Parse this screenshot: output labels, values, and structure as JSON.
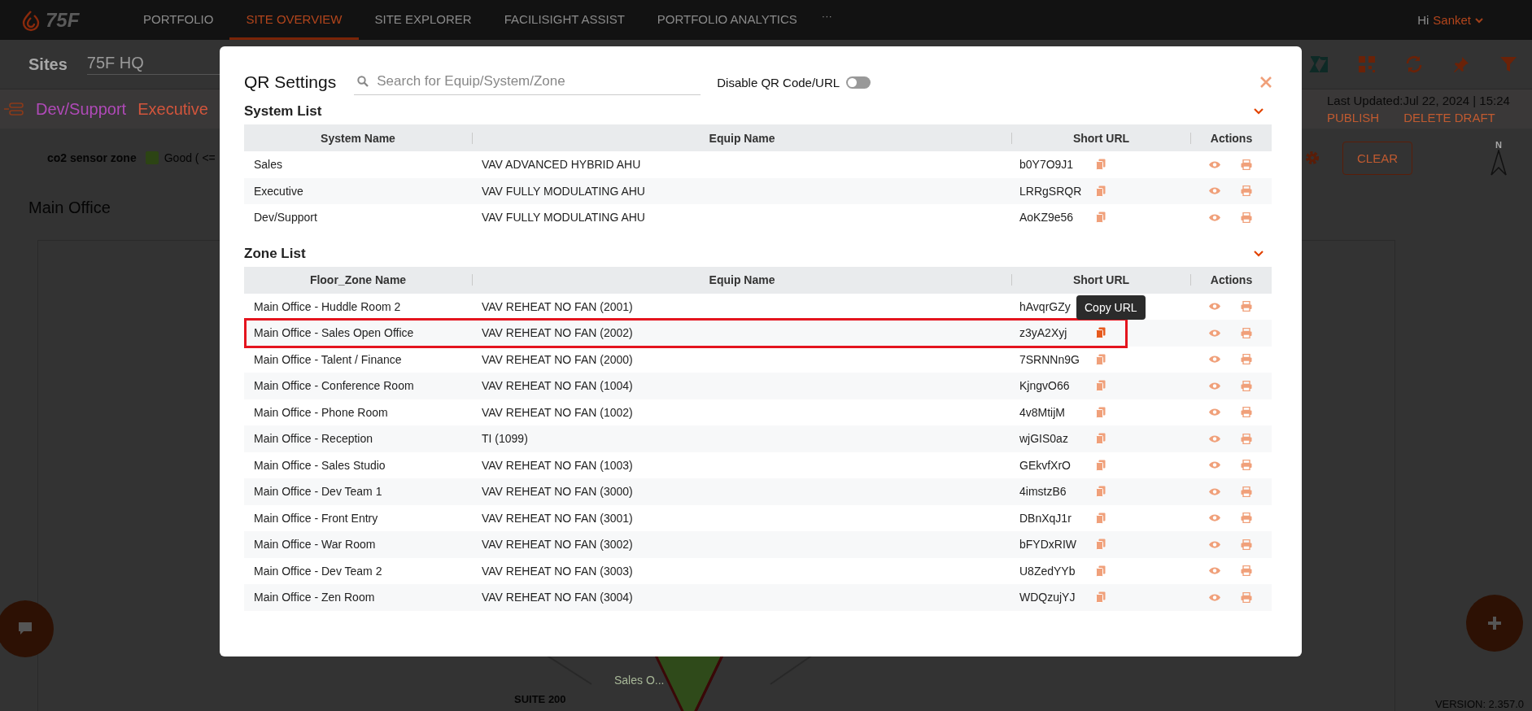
{
  "nav": {
    "logo": "75F",
    "items": [
      {
        "label": "PORTFOLIO",
        "selected": false
      },
      {
        "label": "SITE OVERVIEW",
        "selected": true
      },
      {
        "label": "SITE EXPLORER",
        "selected": false
      },
      {
        "label": "FACILISIGHT ASSIST",
        "selected": false
      },
      {
        "label": "PORTFOLIO ANALYTICS",
        "selected": false
      }
    ],
    "more": "···",
    "greeting": "Hi",
    "user": "Sanket"
  },
  "site_bar": {
    "label": "Sites",
    "site": "75F HQ"
  },
  "filter_tags": [
    {
      "label": "Dev/Support",
      "color": "#b04ab8"
    },
    {
      "label": "Executive",
      "color": "#d2553c"
    }
  ],
  "draft": {
    "last_updated": "Last Updated:Jul 22, 2024 | 15:24",
    "actions": [
      "PUBLISH",
      "DELETE DRAFT"
    ]
  },
  "legend": {
    "title": "co2 sensor zone",
    "items": [
      {
        "label": "Good ( <=",
        "color": "#2c4414"
      }
    ]
  },
  "clear_button": "CLEAR",
  "compass": "N",
  "floor": {
    "title": "Main Office",
    "zone_label": "Sales O...",
    "suite_label": "SUITE 200"
  },
  "version": "VERSION: 2.357.0",
  "modal": {
    "title": "QR Settings",
    "search": {
      "placeholder": "Search for Equip/System/Zone"
    },
    "toggle": {
      "label": "Disable QR Code/URL",
      "on": false
    },
    "sections": [
      {
        "title": "System List",
        "expanded": true,
        "columns": [
          "System Name",
          "Equip Name",
          "Short URL",
          "Actions"
        ],
        "rows": [
          {
            "name": "Sales",
            "equip": "VAV ADVANCED HYBRID AHU",
            "short_url": "b0Y7O9J1",
            "highlighted": false
          },
          {
            "name": "Executive",
            "equip": "VAV FULLY MODULATING AHU",
            "short_url": "LRRgSRQR",
            "highlighted": false
          },
          {
            "name": "Dev/Support",
            "equip": "VAV FULLY MODULATING AHU",
            "short_url": "AoKZ9e56",
            "highlighted": false
          }
        ]
      },
      {
        "title": "Zone List",
        "expanded": true,
        "columns": [
          "Floor_Zone Name",
          "Equip Name",
          "Short URL",
          "Actions"
        ],
        "rows": [
          {
            "name": "Main Office - Huddle Room 2",
            "equip": "VAV REHEAT NO FAN (2001)",
            "short_url": "hAvqrGZy",
            "highlighted": false
          },
          {
            "name": "Main Office - Sales Open Office",
            "equip": "VAV REHEAT NO FAN (2002)",
            "short_url": "z3yA2Xyj",
            "highlighted": true,
            "tooltip": "Copy URL"
          },
          {
            "name": "Main Office - Talent / Finance",
            "equip": "VAV REHEAT NO FAN (2000)",
            "short_url": "7SRNNn9G",
            "highlighted": false
          },
          {
            "name": "Main Office - Conference Room",
            "equip": "VAV REHEAT NO FAN (1004)",
            "short_url": "KjngvO66",
            "highlighted": false
          },
          {
            "name": "Main Office - Phone Room",
            "equip": "VAV REHEAT NO FAN (1002)",
            "short_url": "4v8MtijM",
            "highlighted": false
          },
          {
            "name": "Main Office - Reception",
            "equip": "TI (1099)",
            "short_url": "wjGIS0az",
            "highlighted": false
          },
          {
            "name": "Main Office - Sales Studio",
            "equip": "VAV REHEAT NO FAN (1003)",
            "short_url": "GEkvfXrO",
            "highlighted": false
          },
          {
            "name": "Main Office - Dev Team 1",
            "equip": "VAV REHEAT NO FAN (3000)",
            "short_url": "4imstzB6",
            "highlighted": false
          },
          {
            "name": "Main Office - Front Entry",
            "equip": "VAV REHEAT NO FAN (3001)",
            "short_url": "DBnXqJ1r",
            "highlighted": false
          },
          {
            "name": "Main Office - War Room",
            "equip": "VAV REHEAT NO FAN (3002)",
            "short_url": "bFYDxRIW",
            "highlighted": false
          },
          {
            "name": "Main Office - Dev Team 2",
            "equip": "VAV REHEAT NO FAN (3003)",
            "short_url": "U8ZedYYb",
            "highlighted": false
          },
          {
            "name": "Main Office - Zen Room",
            "equip": "VAV REHEAT NO FAN (3004)",
            "short_url": "WDQzujYJ",
            "highlighted": false
          }
        ]
      }
    ]
  }
}
